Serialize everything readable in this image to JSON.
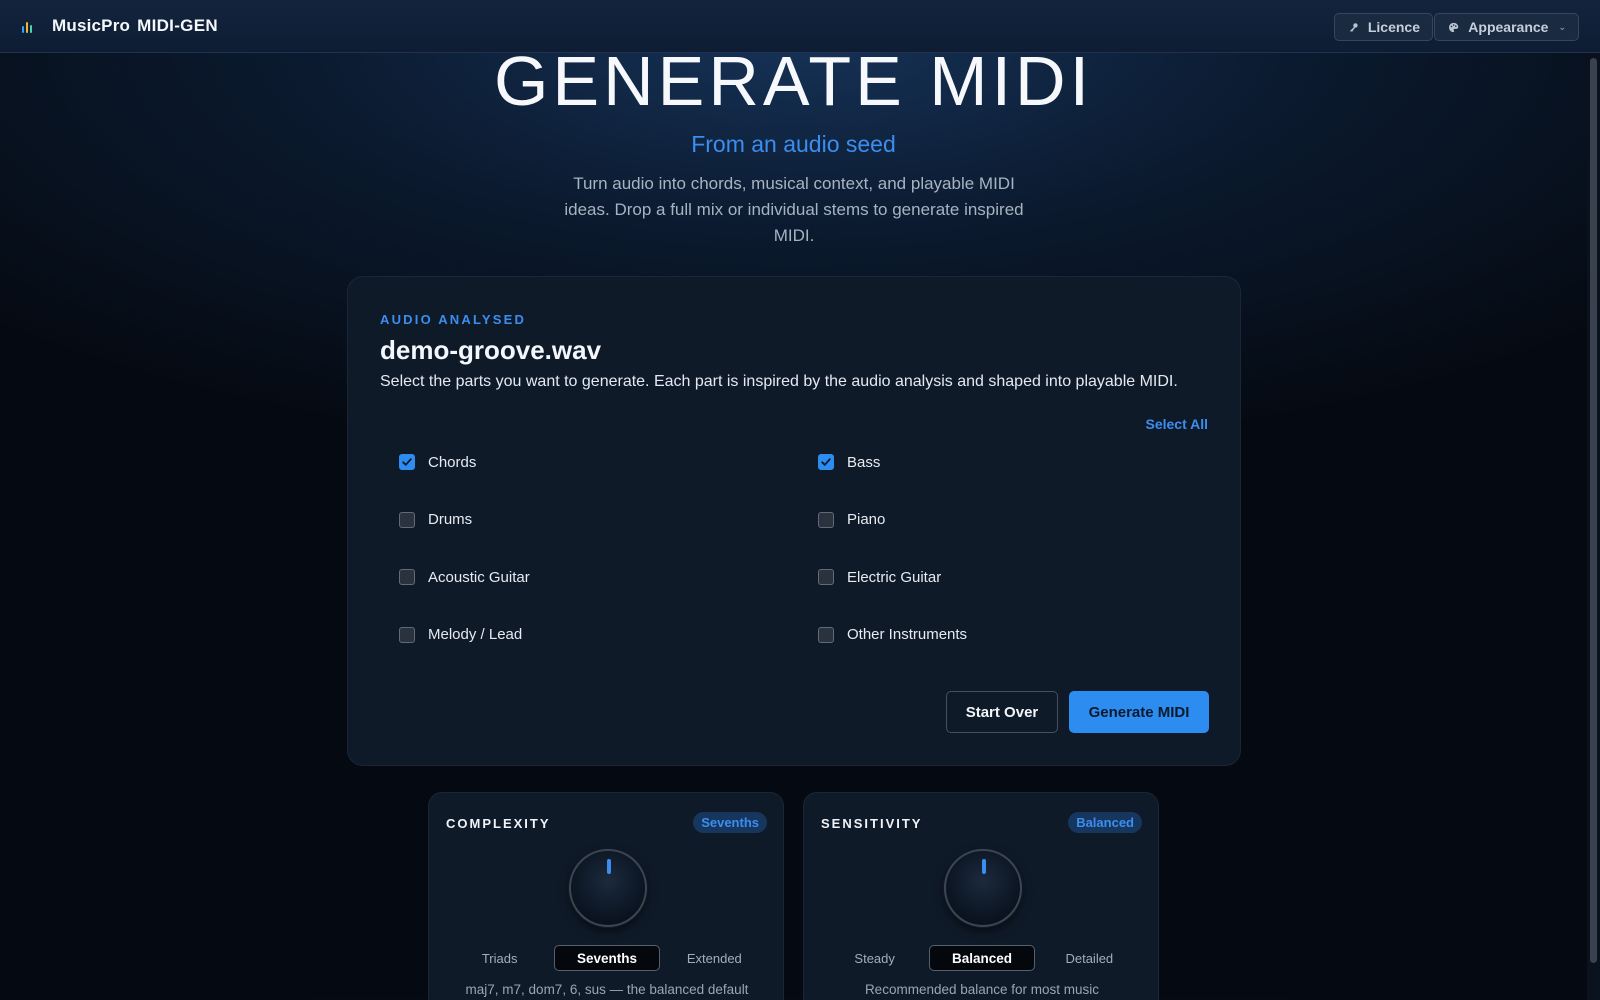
{
  "app": {
    "name": "MusicPro",
    "product": "MIDI-GEN"
  },
  "topbar": {
    "licence_label": "Licence",
    "appearance_label": "Appearance",
    "licence_icon": "key-icon",
    "appearance_icon": "palette-icon"
  },
  "hero": {
    "title": "GENERATE MIDI",
    "subtitle": "From an audio seed",
    "description": "Turn audio into chords, musical context, and playable MIDI ideas. Drop a full mix or individual stems to generate inspired MIDI."
  },
  "card": {
    "eyebrow": "AUDIO ANALYSED",
    "filename": "demo-groove.wav",
    "description": "Select the parts you want to generate. Each part is inspired by the audio analysis and shaped into playable MIDI.",
    "select_all_label": "Select All",
    "parts": [
      {
        "label": "Chords",
        "checked": true
      },
      {
        "label": "Bass",
        "checked": true
      },
      {
        "label": "Drums",
        "checked": false
      },
      {
        "label": "Piano",
        "checked": false
      },
      {
        "label": "Acoustic Guitar",
        "checked": false
      },
      {
        "label": "Electric Guitar",
        "checked": false
      },
      {
        "label": "Melody / Lead",
        "checked": false
      },
      {
        "label": "Other Instruments",
        "checked": false
      }
    ],
    "start_over_label": "Start Over",
    "generate_label": "Generate MIDI"
  },
  "complexity": {
    "title": "COMPLEXITY",
    "badge": "Sevenths",
    "options": [
      "Triads",
      "Sevenths",
      "Extended"
    ],
    "selected": "Sevenths",
    "note": "maj7, m7, dom7, 6, sus — the balanced default"
  },
  "sensitivity": {
    "title": "SENSITIVITY",
    "badge": "Balanced",
    "options": [
      "Steady",
      "Balanced",
      "Detailed"
    ],
    "selected": "Balanced",
    "note": "Recommended balance for most music"
  },
  "colors": {
    "accent": "#2d8cf0",
    "background": "#050a12",
    "card": "#0f1a29"
  }
}
